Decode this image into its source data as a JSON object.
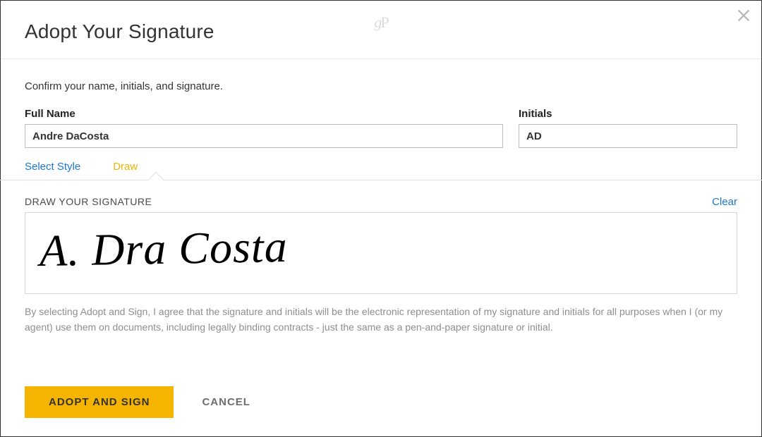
{
  "watermark": "gP",
  "dialog": {
    "title": "Adopt Your Signature",
    "instruction": "Confirm your name, initials, and signature."
  },
  "fields": {
    "fullname_label": "Full Name",
    "fullname_value": "Andre DaCosta",
    "initials_label": "Initials",
    "initials_value": "AD"
  },
  "tabs": {
    "select_style": "Select Style",
    "draw": "Draw"
  },
  "draw_section": {
    "heading": "DRAW YOUR SIGNATURE",
    "clear": "Clear",
    "signature_text": "A. Dra Costa"
  },
  "legal": "By selecting Adopt and Sign, I agree that the signature and initials will be the electronic representation of my signature and initials for all purposes when I (or my agent) use them on documents, including legally binding contracts - just the same as a pen-and-paper signature or initial.",
  "buttons": {
    "adopt": "ADOPT AND SIGN",
    "cancel": "CANCEL"
  }
}
